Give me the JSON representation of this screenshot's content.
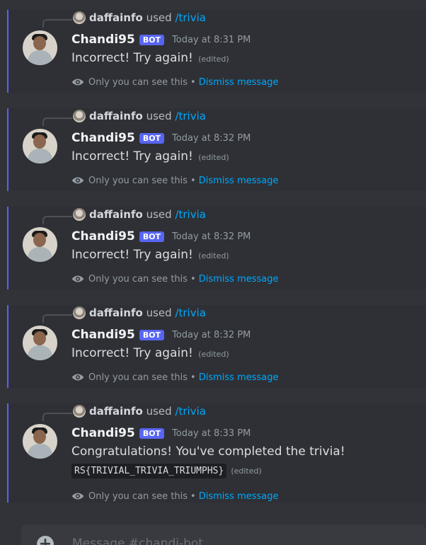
{
  "messages": [
    {
      "reply_user": "daffainfo",
      "reply_used": "used",
      "reply_command": "/trivia",
      "author": "Chandi95",
      "bot_tag": "BOT",
      "timestamp": "Today at 8:31 PM",
      "content": "Incorrect! Try again!",
      "edited": "(edited)",
      "ephemeral_text": "Only you can see this",
      "dot": "•",
      "dismiss": "Dismiss message"
    },
    {
      "reply_user": "daffainfo",
      "reply_used": "used",
      "reply_command": "/trivia",
      "author": "Chandi95",
      "bot_tag": "BOT",
      "timestamp": "Today at 8:32 PM",
      "content": "Incorrect! Try again!",
      "edited": "(edited)",
      "ephemeral_text": "Only you can see this",
      "dot": "•",
      "dismiss": "Dismiss message"
    },
    {
      "reply_user": "daffainfo",
      "reply_used": "used",
      "reply_command": "/trivia",
      "author": "Chandi95",
      "bot_tag": "BOT",
      "timestamp": "Today at 8:32 PM",
      "content": "Incorrect! Try again!",
      "edited": "(edited)",
      "ephemeral_text": "Only you can see this",
      "dot": "•",
      "dismiss": "Dismiss message"
    },
    {
      "reply_user": "daffainfo",
      "reply_used": "used",
      "reply_command": "/trivia",
      "author": "Chandi95",
      "bot_tag": "BOT",
      "timestamp": "Today at 8:32 PM",
      "content": "Incorrect! Try again!",
      "edited": "(edited)",
      "ephemeral_text": "Only you can see this",
      "dot": "•",
      "dismiss": "Dismiss message"
    },
    {
      "reply_user": "daffainfo",
      "reply_used": "used",
      "reply_command": "/trivia",
      "author": "Chandi95",
      "bot_tag": "BOT",
      "timestamp": "Today at 8:33 PM",
      "content": "Congratulations! You've completed the trivia!",
      "code": "RS{TRIVIAL_TRIVIA_TRIUMPHS}",
      "edited": "(edited)",
      "ephemeral_text": "Only you can see this",
      "dot": "•",
      "dismiss": "Dismiss message"
    }
  ],
  "composer": {
    "placeholder": "Message #chandi-bot",
    "plus_icon": "plus-circle-icon"
  },
  "colors": {
    "background": "#313338",
    "ephemeral_highlight": "#2e3035",
    "accent_bar": "#5865f2",
    "link": "#00a8fc"
  }
}
